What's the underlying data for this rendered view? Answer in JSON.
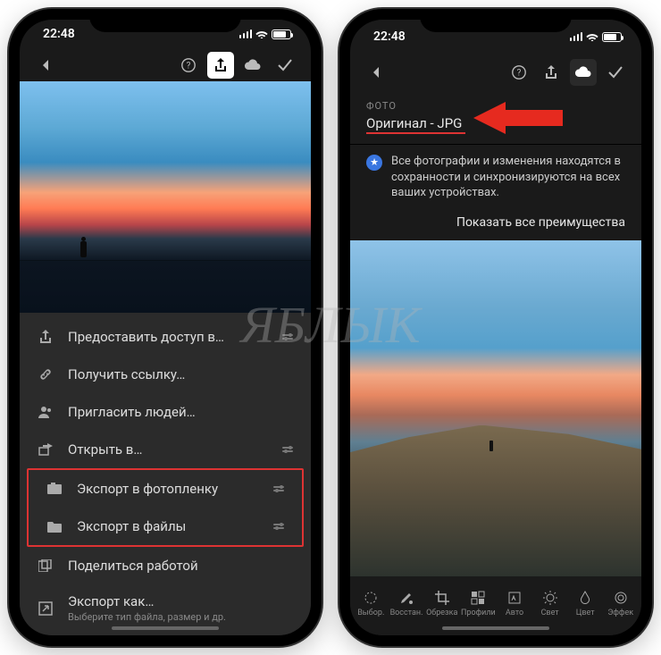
{
  "statusbar": {
    "time": "22:48"
  },
  "share_menu": {
    "share_access": "Предоставить доступ в…",
    "get_link": "Получить ссылку…",
    "invite_people": "Пригласить людей…",
    "open_in": "Открыть в…",
    "export_camera_roll": "Экспорт в фотопленку",
    "export_files": "Экспорт в файлы",
    "share_work": "Поделиться работой",
    "export_as": "Экспорт как…",
    "export_as_sub": "Выберите тип файла, размер и др."
  },
  "info_panel": {
    "section": "ФОТО",
    "format": "Оригинал - JPG",
    "sync_text": "Все фотографии и изменения находятся в сохранности и синхронизируются на всех ваших устройствах.",
    "benefits_link": "Показать все преимущества"
  },
  "tools": {
    "select": "Выбор.",
    "heal": "Восстан.",
    "crop": "Обрезка",
    "profiles": "Профили",
    "auto": "Авто",
    "light": "Свет",
    "color": "Цвет",
    "effects": "Эффек"
  },
  "watermark": "ЯБЛЫК"
}
